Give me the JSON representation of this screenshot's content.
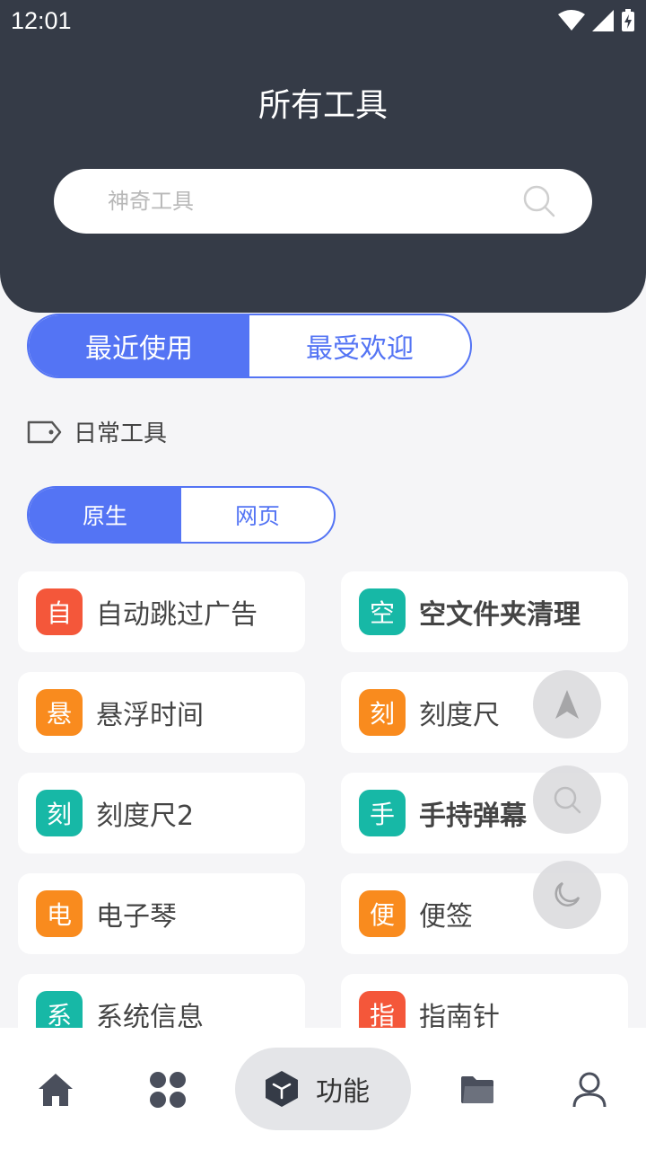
{
  "status_bar": {
    "time": "12:01"
  },
  "header": {
    "title": "所有工具"
  },
  "search": {
    "placeholder": "神奇工具"
  },
  "main_tabs": [
    {
      "label": "最近使用",
      "active": true
    },
    {
      "label": "最受欢迎",
      "active": false
    }
  ],
  "category": {
    "label": "日常工具"
  },
  "sub_tabs": [
    {
      "label": "原生",
      "active": true
    },
    {
      "label": "网页",
      "active": false
    }
  ],
  "tools": [
    {
      "badge": "自",
      "name": "自动跳过广告",
      "color": "#f4573a"
    },
    {
      "badge": "空",
      "name": "空文件夹清理",
      "color": "#17b8a6"
    },
    {
      "badge": "悬",
      "name": "悬浮时间",
      "color": "#f98b1e"
    },
    {
      "badge": "刻",
      "name": "刻度尺",
      "color": "#f98b1e"
    },
    {
      "badge": "刻",
      "name": "刻度尺2",
      "color": "#17b8a6"
    },
    {
      "badge": "手",
      "name": "手持弹幕",
      "color": "#17b8a6"
    },
    {
      "badge": "电",
      "name": "电子琴",
      "color": "#f98b1e"
    },
    {
      "badge": "便",
      "name": "便签",
      "color": "#f98b1e"
    },
    {
      "badge": "系",
      "name": "系统信息",
      "color": "#17b8a6"
    },
    {
      "badge": "指",
      "name": "指南针",
      "color": "#f4573a"
    }
  ],
  "floating_buttons": [
    "navigate-icon",
    "search-icon",
    "moon-icon"
  ],
  "bottom_nav": {
    "items": [
      "home-icon",
      "apps-icon",
      "cube-icon",
      "folder-icon",
      "user-icon"
    ],
    "active_label": "功能"
  },
  "colors": {
    "accent": "#5474f4",
    "header_bg": "#353b47"
  }
}
